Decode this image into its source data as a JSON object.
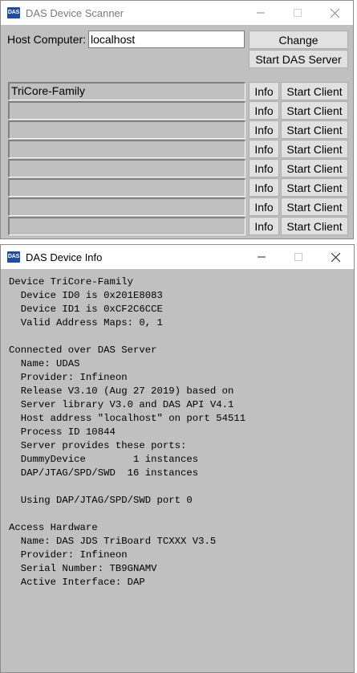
{
  "scanner": {
    "title": "DAS Device Scanner",
    "logo": "DAS",
    "host_label": "Host Computer:",
    "host_value": "localhost",
    "change_label": "Change",
    "start_server_label": "Start DAS Server",
    "devices": [
      "TriCore-Family",
      "",
      "",
      "",
      "",
      "",
      "",
      ""
    ],
    "info_label": "Info",
    "start_client_label": "Start Client"
  },
  "info": {
    "title": "DAS Device Info",
    "logo": "DAS",
    "lines": [
      "Device TriCore-Family",
      "  Device ID0 is 0x201E8083",
      "  Device ID1 is 0xCF2C6CCE",
      "  Valid Address Maps: 0, 1",
      "",
      "Connected over DAS Server",
      "  Name: UDAS",
      "  Provider: Infineon",
      "  Release V3.10 (Aug 27 2019) based on",
      "  Server library V3.0 and DAS API V4.1",
      "  Host address \"localhost\" on port 54511",
      "  Process ID 10844",
      "  Server provides these ports:",
      "  DummyDevice        1 instances",
      "  DAP/JTAG/SPD/SWD  16 instances",
      "",
      "  Using DAP/JTAG/SPD/SWD port 0",
      "",
      "Access Hardware",
      "  Name: DAS JDS TriBoard TCXXX V3.5",
      "  Provider: Infineon",
      "  Serial Number: TB9GNAMV",
      "  Active Interface: DAP"
    ]
  },
  "icons": {
    "minimize": "minimize-icon",
    "maximize": "maximize-icon",
    "close": "close-icon"
  }
}
